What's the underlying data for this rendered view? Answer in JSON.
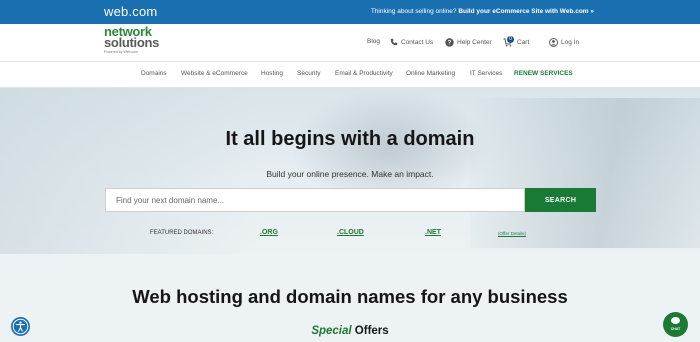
{
  "topbar": {
    "brand": "web.com",
    "promo_text": "Thinking about selling online?",
    "promo_link": "Build your eCommerce Site with Web.com »"
  },
  "header": {
    "logo_line1": "network",
    "logo_line2": "solutions",
    "logo_line3": "Powered by Web.com",
    "utility": {
      "blog": "Blog",
      "contact": "Contact Us",
      "help": "Help Center",
      "cart_count": "0",
      "cart": "Cart",
      "login": "Log In"
    }
  },
  "nav": {
    "items": [
      "Domains",
      "Website & eCommerce",
      "Hosting",
      "Security",
      "Email & Productivity",
      "Online Marketing",
      "IT Services",
      "RENEW SERVICES"
    ]
  },
  "hero": {
    "title": "It all begins with a domain",
    "subtitle": "Build your online presence. Make an impact.",
    "search_placeholder": "Find your next domain name...",
    "search_button": "SEARCH",
    "featured_label": "FEATURED DOMAINS:",
    "featured_tlds": [
      ".ORG",
      ".CLOUD",
      ".NET"
    ],
    "offer_details": "Offer Details"
  },
  "lower": {
    "title": "Web hosting and domain names for any business",
    "offers_special": "Special",
    "offers_rest": "Offers"
  },
  "chat": {
    "label": "CHAT"
  },
  "colors": {
    "topbar": "#1a6fb1",
    "accent_green": "#1d7a34",
    "hero_bg": "#dde8ec",
    "lower_bg": "#edf2f4"
  }
}
